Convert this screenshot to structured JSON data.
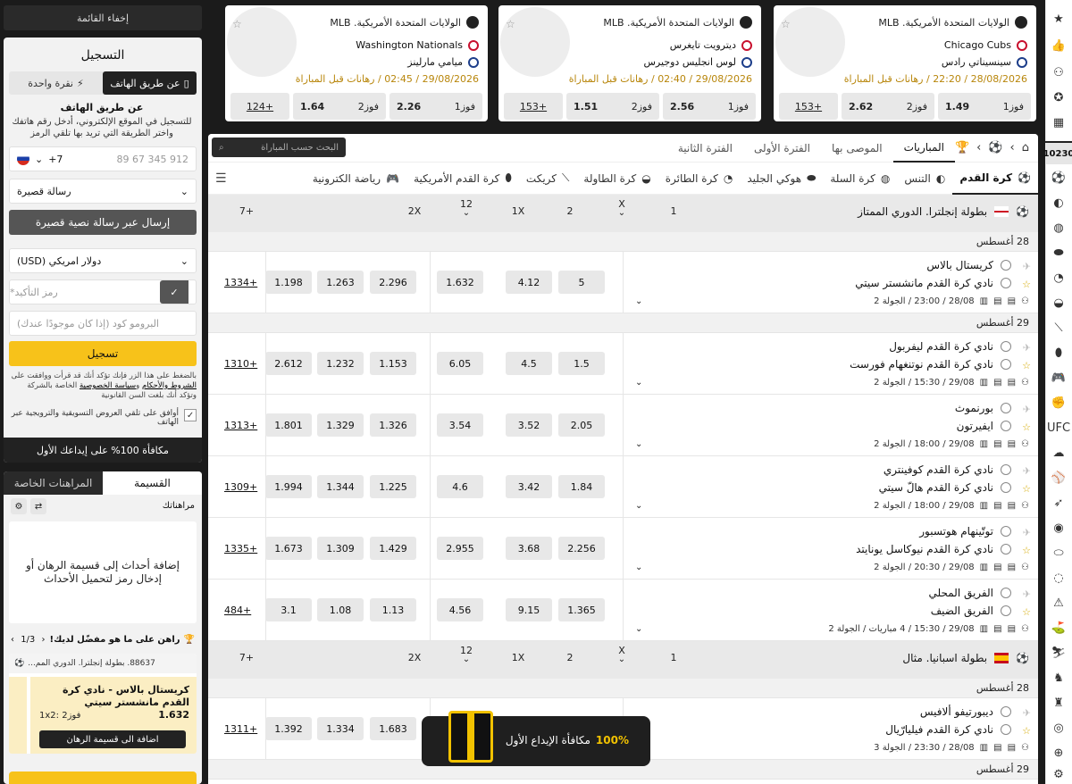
{
  "sidebar": {
    "hide_menu": "إخفاء القائمة",
    "register": {
      "title": "التسجيل",
      "tab_phone": "عن طريق الهاتف",
      "tab_oneclick": "نقرة واحدة",
      "subtitle": "عن طريق الهاتف",
      "desc": "للتسجيل في الموقع الإلكتروني، أدخل رقم هاتفك واختر الطريقة التي تريد بها تلقي الرمز",
      "phone_code": "+7",
      "phone_placeholder": "912 345 67 89",
      "method": "رسالة قصيرة",
      "send_sms": "إرسال عبر رسالة نصية قصيرة",
      "currency": "دولار امريكي (USD)",
      "confirm_placeholder": "رمز التأكيد*",
      "promo_placeholder": "البرومو كود (إذا كان موجودًا عندك)",
      "submit": "تسجيل",
      "legal_pre": "بالضغط على هذا الزر فإنك تؤكد أنك قد قرأت ووافقت على",
      "legal_terms": "الشروط والأحكام",
      "legal_and": " و",
      "legal_privacy": "سياسة الخصوصية",
      "legal_post": " الخاصة بالشركة وتؤكد أنك بلغت السن القانونية",
      "consent": "أوافق على تلقي العروض التسويقية والترويجية عبر الهاتف",
      "bonus": "مكافأة 100% على إيداعك الأول"
    },
    "slip": {
      "tab_slip": "القسيمة",
      "tab_private": "المراهنات الخاصة",
      "toolbar_label": "مراهناتك",
      "empty": "إضافة أحداث إلى قسيمة الرهان أو إدخال رمز لتحميل الأحداث",
      "promo_title": "راهن على ما هو مفضّل لديك!",
      "pager": "1/3",
      "card_league": "88637. بطولة إنجلترا. الدوري المم...",
      "card_match": "كريستال بالاس - نادي كرة القدم مانشستر سيتي",
      "card_odd": "1.632",
      "card_pick": "فوز2 :1x2",
      "card_add": "اضافة الى قسيمة الرهان"
    }
  },
  "top_cards": [
    {
      "league": "الولايات المتحدة الأمريكية. MLB",
      "team1": "Chicago Cubs",
      "team2": "سينسيناتي رادس",
      "date": "28/08/2026 / 22:20 / رهانات قبل المباراة",
      "w1_label": "فوز1",
      "w1": "1.49",
      "w2_label": "فوز2",
      "w2": "2.62",
      "more": "+153"
    },
    {
      "league": "الولايات المتحدة الأمريكية. MLB",
      "team1": "ديترويت تايغرس",
      "team2": "لوس انجليس دوجيرس",
      "date": "29/08/2026 / 02:40 / رهانات قبل المباراة",
      "w1_label": "فوز1",
      "w1": "2.56",
      "w2_label": "فوز2",
      "w2": "1.51",
      "more": "+153"
    },
    {
      "league": "الولايات المتحدة الأمريكية. MLB",
      "team1": "Washington Nationals",
      "team2": "ميامي مارلينز",
      "date": "29/08/2026 / 02:45 / رهانات قبل المباراة",
      "w1_label": "فوز1",
      "w1": "2.26",
      "w2_label": "فوز2",
      "w2": "1.64",
      "more": "+124"
    }
  ],
  "nav1": {
    "tabs": [
      "المباريات",
      "الموصى بها",
      "الفترة الأولى",
      "الفترة الثانية"
    ],
    "search_placeholder": "البحث حسب المباراة"
  },
  "sports": [
    "كرة القدم",
    "التنس",
    "كرة السلة",
    "هوكي الجليد",
    "كرة الطائرة",
    "كرة الطاولة",
    "كريكت",
    "كرة القدم الأمريكية",
    "رياضة الكترونية"
  ],
  "columns": [
    "1",
    "X",
    "2",
    "1X",
    "12",
    "2X",
    "+7"
  ],
  "leagues": [
    {
      "name": "بطولة إنجلترا. الدوري الممتاز",
      "flag": "england",
      "days": [
        {
          "date": "28 أغسطس",
          "matches": [
            {
              "t1": "كريستال بالاس",
              "t2": "نادي كرة القدم مانشستر سيتي",
              "meta": "28/08 / 23:00 / الجولة 2",
              "odds": [
                "5",
                "4.12",
                "1.632",
                "2.296",
                "1.263",
                "1.198"
              ],
              "more": "+1334"
            }
          ]
        },
        {
          "date": "29 أغسطس",
          "matches": [
            {
              "t1": "نادي كرة القدم ليفربول",
              "t2": "نادي كرة القدم نوتنغهام فورست",
              "meta": "29/08 / 15:30 / الجولة 2",
              "odds": [
                "1.5",
                "4.5",
                "6.05",
                "1.153",
                "1.232",
                "2.612"
              ],
              "more": "+1310"
            },
            {
              "t1": "بورنموث",
              "t2": "ايفيرتون",
              "meta": "29/08 / 18:00 / الجولة 2",
              "odds": [
                "2.05",
                "3.52",
                "3.54",
                "1.326",
                "1.329",
                "1.801"
              ],
              "more": "+1313"
            },
            {
              "t1": "نادي كرة القدم كوفينتري",
              "t2": "نادي كرة القدم هالّ سيتي",
              "meta": "29/08 / 18:00 / الجولة 2",
              "odds": [
                "1.84",
                "3.42",
                "4.6",
                "1.225",
                "1.344",
                "1.994"
              ],
              "more": "+1309"
            },
            {
              "t1": "توتّينهام هوتسبور",
              "t2": "نادي كرة القدم نيوكاسل يونايتد",
              "meta": "29/08 / 20:30 / الجولة 2",
              "odds": [
                "2.256",
                "3.68",
                "2.955",
                "1.429",
                "1.309",
                "1.673"
              ],
              "more": "+1335"
            },
            {
              "t1": "الفريق المحلي",
              "t2": "الفريق الضيف",
              "meta": "29/08 / 15:30 / 4 مباريات / الجولة 2",
              "odds": [
                "1.365",
                "9.15",
                "4.56",
                "1.13",
                "1.08",
                "3.1"
              ],
              "more": "+484"
            }
          ]
        }
      ]
    },
    {
      "name": "بطولة اسبانيا. مثال",
      "flag": "spain",
      "days": [
        {
          "date": "28 أغسطس",
          "matches": [
            {
              "t1": "ديبورتيفو ألافيس",
              "t2": "نادي كرة القدم فيليارّيال",
              "meta": "28/08 / 23:30 / الجولة 3",
              "odds": [
                "",
                "",
                "",
                "1.683",
                "1.334",
                "1.392"
              ],
              "more": "+1311"
            }
          ]
        },
        {
          "date": "29 أغسطس",
          "matches": []
        }
      ]
    }
  ],
  "rail_counter": "10230",
  "banner": {
    "pct": "100%",
    "text": "مكافأة الإيداع الأول"
  },
  "colors": {
    "accent": "#f7c21a",
    "dark": "#222222",
    "odds_bg": "#e8e8e8"
  }
}
